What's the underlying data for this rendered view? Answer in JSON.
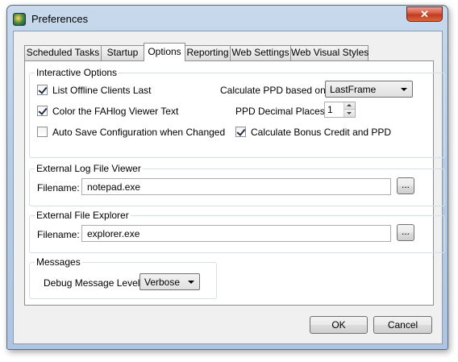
{
  "window": {
    "title": "Preferences",
    "close_glyph": "✕"
  },
  "tabs": [
    {
      "label": "Scheduled Tasks",
      "active": false
    },
    {
      "label": "Startup",
      "active": false
    },
    {
      "label": "Options",
      "active": true
    },
    {
      "label": "Reporting",
      "active": false
    },
    {
      "label": "Web Settings",
      "active": false
    },
    {
      "label": "Web Visual Styles",
      "active": false
    }
  ],
  "interactive_options": {
    "title": "Interactive Options",
    "list_offline": {
      "label": "List Offline Clients Last",
      "checked": true
    },
    "color_log": {
      "label": "Color the FAHlog Viewer Text",
      "checked": true
    },
    "auto_save": {
      "label": "Auto Save Configuration when Changed",
      "checked": false
    },
    "calc_ppd_label": "Calculate PPD based on:",
    "calc_ppd_value": "LastFrame",
    "ppd_decimal_label": "PPD Decimal Places:",
    "ppd_decimal_value": "1",
    "bonus_credit": {
      "label": "Calculate Bonus Credit and PPD",
      "checked": true
    }
  },
  "log_viewer": {
    "title": "External Log File Viewer",
    "filename_label": "Filename:",
    "filename_value": "notepad.exe",
    "browse_label": "..."
  },
  "file_explorer": {
    "title": "External File Explorer",
    "filename_label": "Filename:",
    "filename_value": "explorer.exe",
    "browse_label": "..."
  },
  "messages": {
    "title": "Messages",
    "debug_label": "Debug Message Level:",
    "debug_value": "Verbose"
  },
  "footer": {
    "ok_label": "OK",
    "cancel_label": "Cancel"
  }
}
